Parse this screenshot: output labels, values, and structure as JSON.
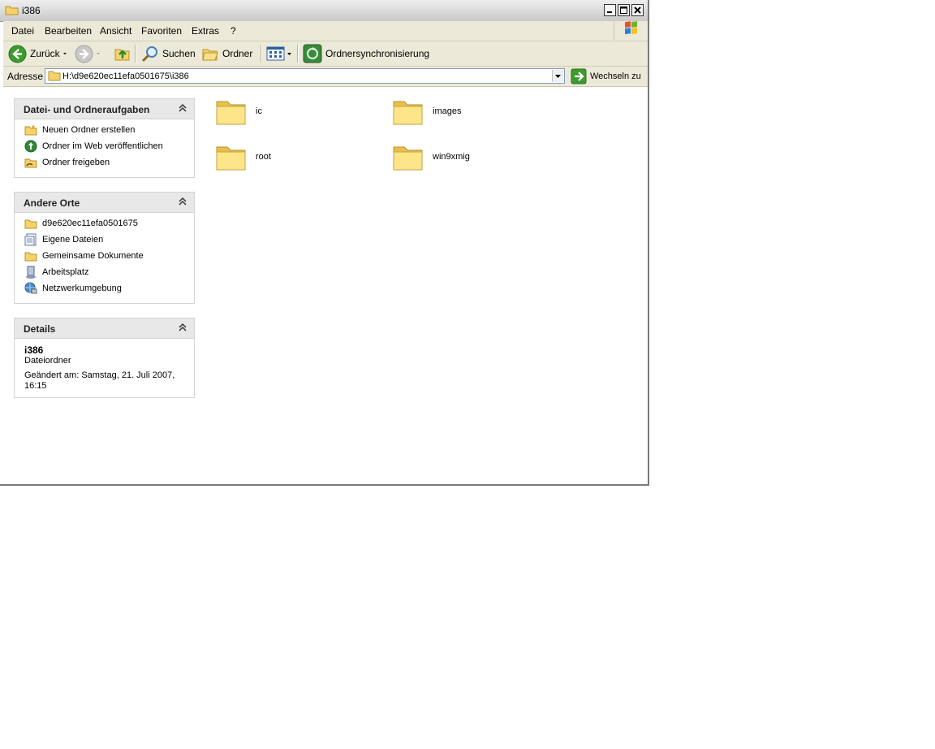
{
  "window": {
    "title": "i386"
  },
  "menu": [
    "Datei",
    "Bearbeiten",
    "Ansicht",
    "Favoriten",
    "Extras",
    "?"
  ],
  "toolbar": {
    "back_label": "Zurück",
    "search_label": "Suchen",
    "folders_label": "Ordner",
    "sync_label": "Ordnersynchronisierung"
  },
  "address": {
    "label": "Adresse",
    "value": "H:\\d9e620ec11efa0501675\\i386",
    "go_label": "Wechseln zu"
  },
  "sidebar": {
    "tasks": {
      "title": "Datei- und Ordneraufgaben",
      "items": [
        "Neuen Ordner erstellen",
        "Ordner im Web veröffentlichen",
        "Ordner freigeben"
      ]
    },
    "places": {
      "title": "Andere Orte",
      "items": [
        "d9e620ec11efa0501675",
        "Eigene Dateien",
        "Gemeinsame Dokumente",
        "Arbeitsplatz",
        "Netzwerkumgebung"
      ]
    },
    "details": {
      "title": "Details",
      "name": "i386",
      "type": "Dateiordner",
      "modified_line1": "Geändert am: Samstag, 21. Juli 2007,",
      "modified_line2": "16:15"
    }
  },
  "folders": [
    "ic",
    "images",
    "root",
    "win9xmig"
  ]
}
